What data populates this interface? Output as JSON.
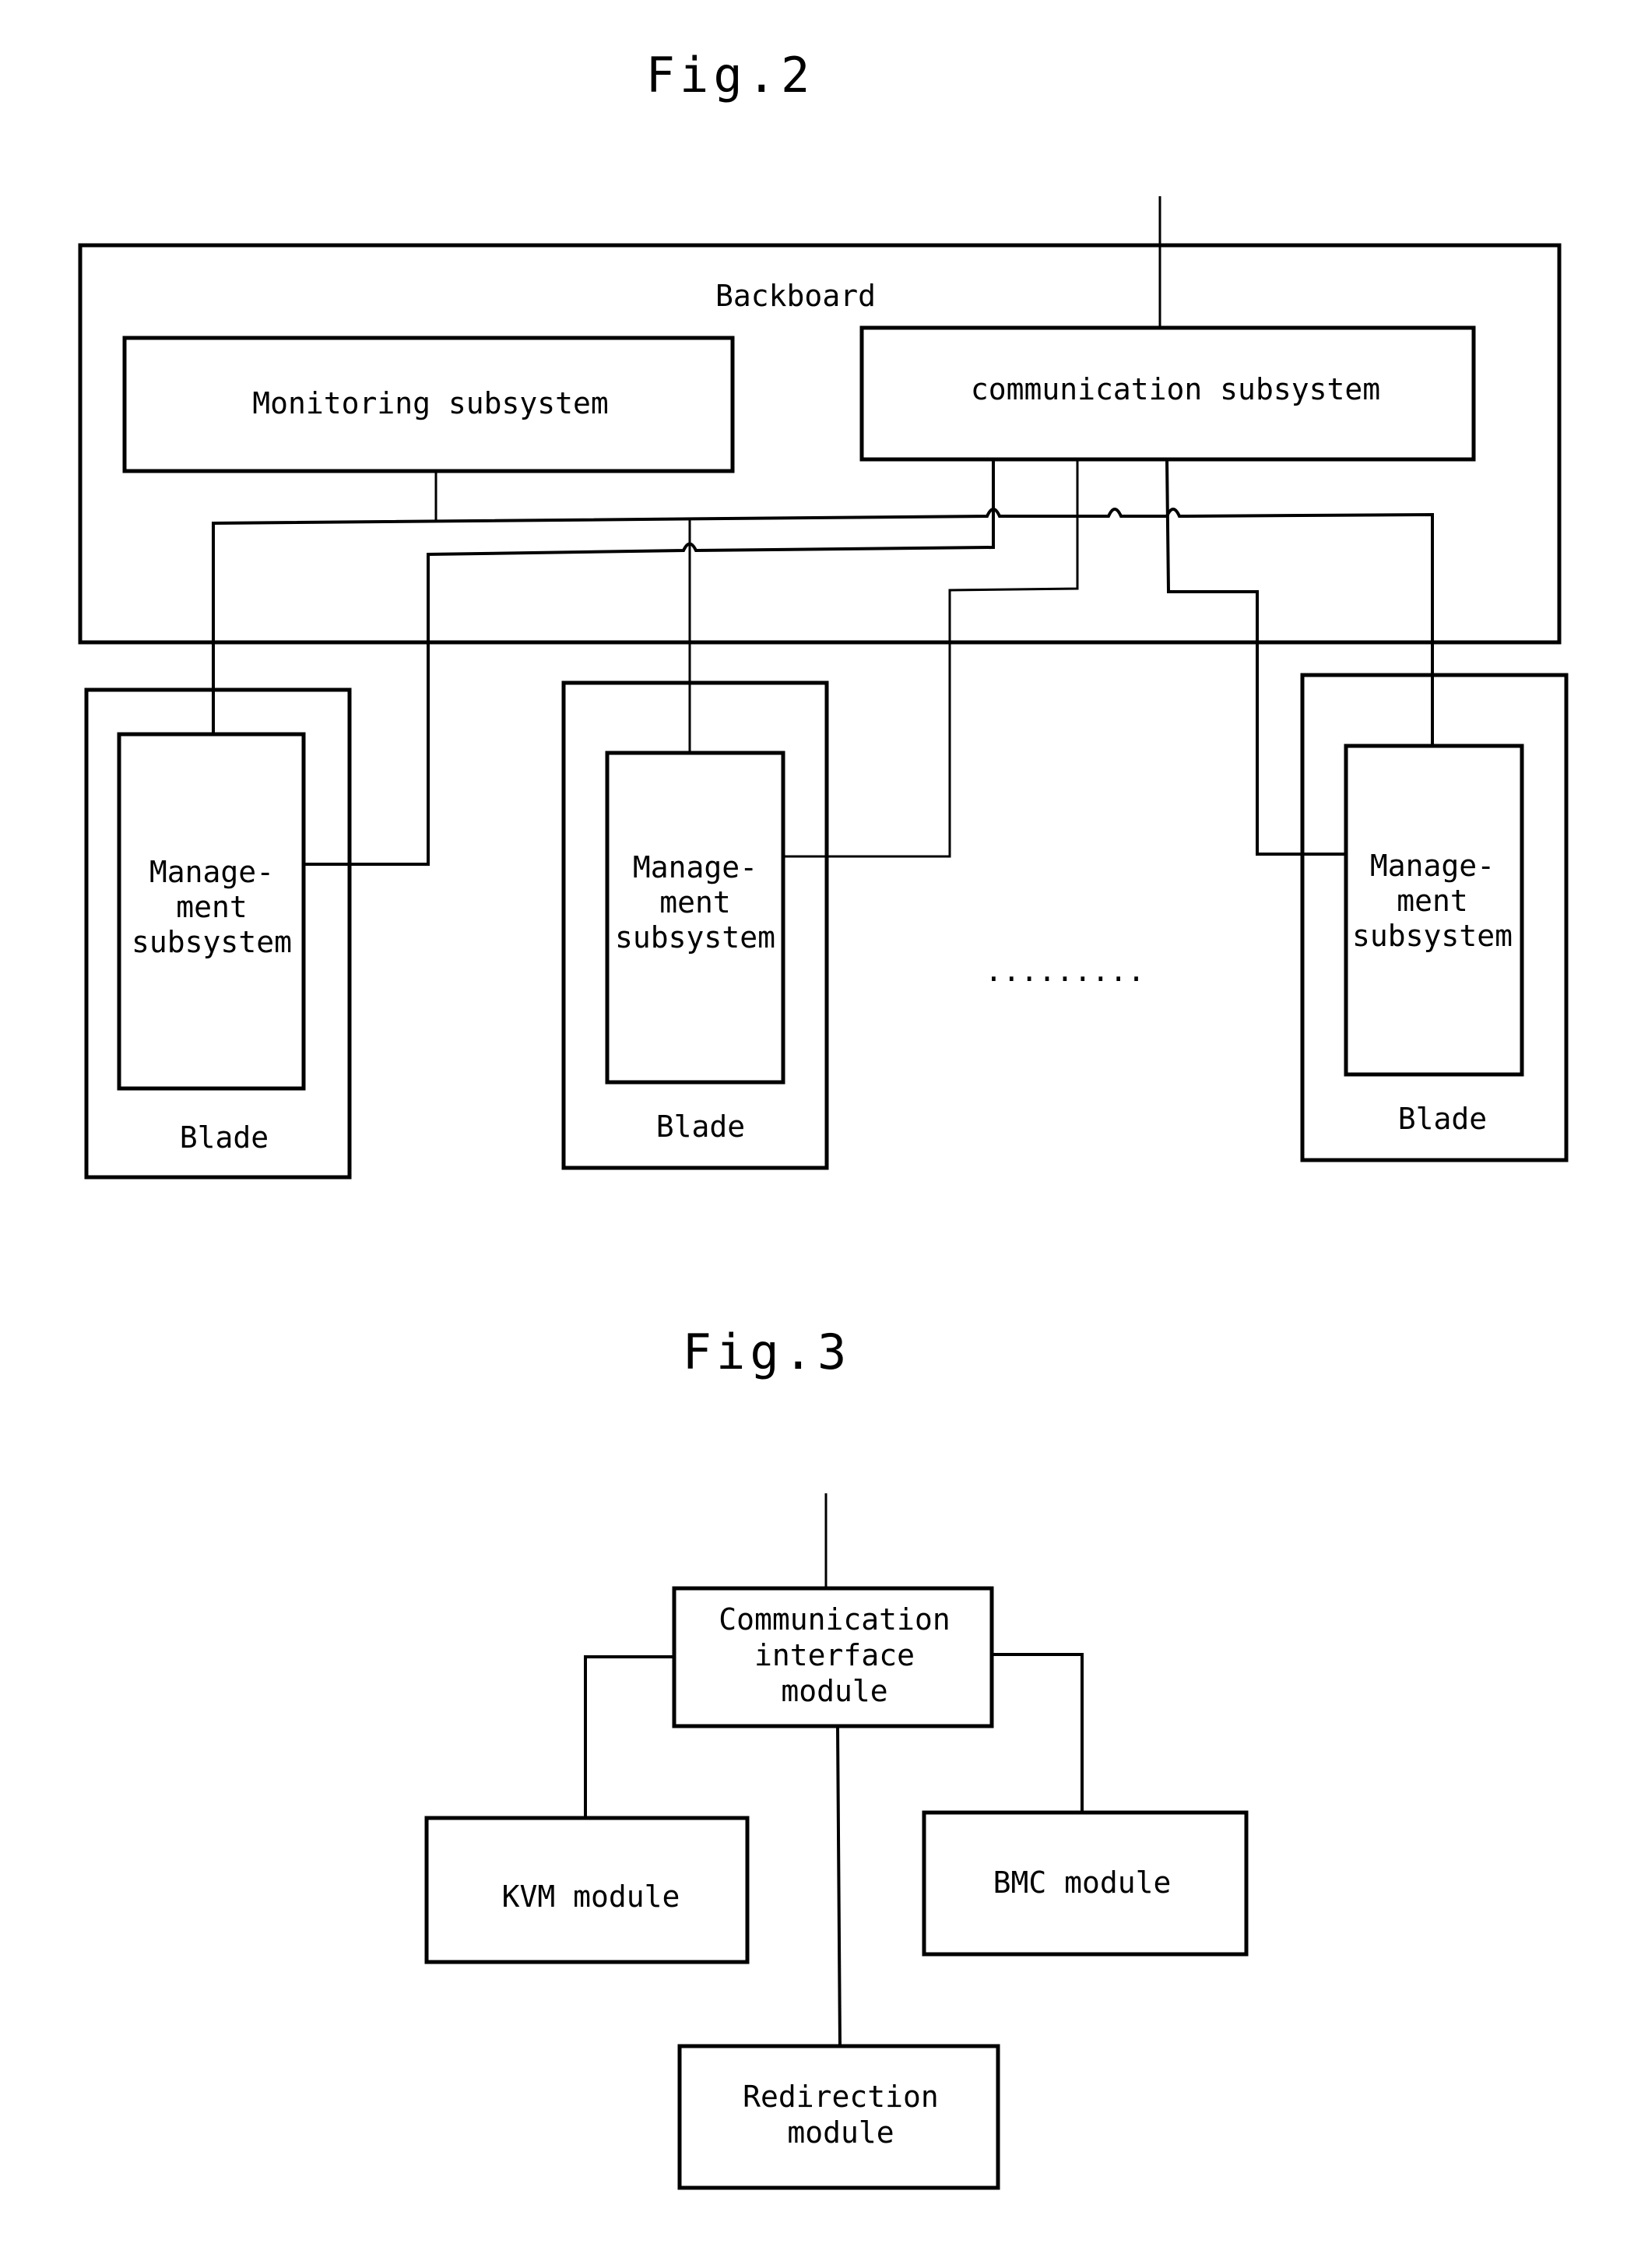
{
  "fig2": {
    "title": "Fig.2",
    "backboard_label": "Backboard",
    "monitoring_label": "Monitoring subsystem",
    "communication_label": "communication subsystem",
    "blades": [
      {
        "blade_label": "Blade",
        "mgmt_lines": [
          "Manage-",
          "ment",
          "subsystem"
        ]
      },
      {
        "blade_label": "Blade",
        "mgmt_lines": [
          "Manage-",
          "ment",
          "subsystem"
        ]
      },
      {
        "blade_label": "Blade",
        "mgmt_lines": [
          "Manage-",
          "ment",
          "subsystem"
        ]
      }
    ],
    "ellipsis": "......... "
  },
  "fig3": {
    "title": "Fig.3",
    "cim_lines": [
      "Communication",
      "interface",
      "module"
    ],
    "kvm_label": "KVM module",
    "bmc_label": "BMC module",
    "redirection_lines": [
      "Redirection",
      "module"
    ]
  },
  "colors": {
    "line": "#000000",
    "background": "#ffffff"
  }
}
